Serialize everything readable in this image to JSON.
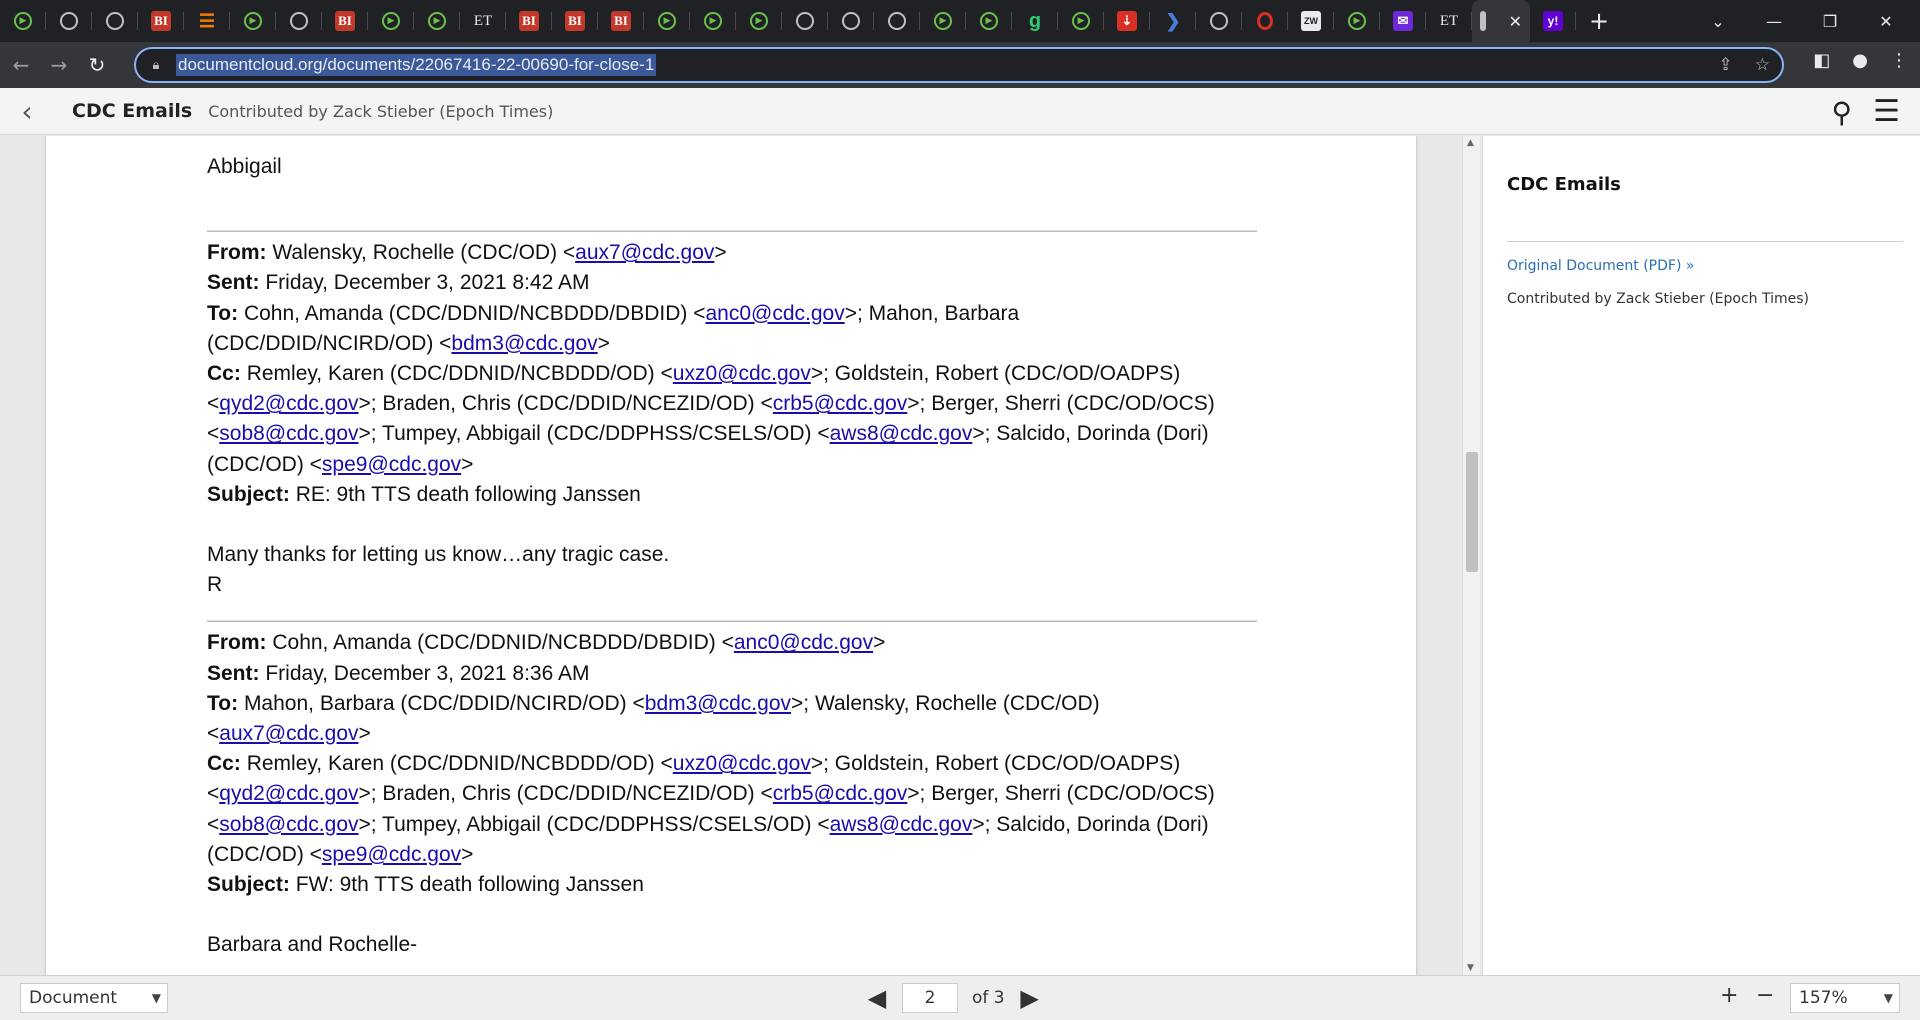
{
  "browser": {
    "tabs": [
      {
        "icon": "play-icon",
        "glyph": "▶",
        "kind": "play"
      },
      {
        "icon": "globe-icon",
        "glyph": "",
        "kind": "globe"
      },
      {
        "icon": "globe-icon",
        "glyph": "",
        "kind": "globe"
      },
      {
        "icon": "bi-icon",
        "glyph": "BI",
        "kind": "bi"
      },
      {
        "icon": "bookmark-icon",
        "glyph": "☰",
        "kind": "bookmark"
      },
      {
        "icon": "play-icon",
        "glyph": "▶",
        "kind": "play"
      },
      {
        "icon": "globe-icon",
        "glyph": "",
        "kind": "globe"
      },
      {
        "icon": "bi-icon",
        "glyph": "BI",
        "kind": "bi"
      },
      {
        "icon": "play-icon",
        "glyph": "▶",
        "kind": "play"
      },
      {
        "icon": "play-icon",
        "glyph": "▶",
        "kind": "play"
      },
      {
        "icon": "et-icon",
        "glyph": "ET",
        "kind": "et"
      },
      {
        "icon": "bi-icon",
        "glyph": "BI",
        "kind": "bi"
      },
      {
        "icon": "bi-icon",
        "glyph": "BI",
        "kind": "bi"
      },
      {
        "icon": "bi-icon",
        "glyph": "BI",
        "kind": "bi"
      },
      {
        "icon": "play-icon",
        "glyph": "▶",
        "kind": "play"
      },
      {
        "icon": "play-icon",
        "glyph": "▶",
        "kind": "play"
      },
      {
        "icon": "play-icon",
        "glyph": "▶",
        "kind": "play"
      },
      {
        "icon": "globe-icon",
        "glyph": "",
        "kind": "globe"
      },
      {
        "icon": "globe-icon",
        "glyph": "",
        "kind": "globe"
      },
      {
        "icon": "globe-icon",
        "glyph": "",
        "kind": "globe"
      },
      {
        "icon": "play-icon",
        "glyph": "▶",
        "kind": "play"
      },
      {
        "icon": "play-icon",
        "glyph": "▶",
        "kind": "play"
      },
      {
        "icon": "g-icon",
        "glyph": "g",
        "kind": "g"
      },
      {
        "icon": "play-icon",
        "glyph": "▶",
        "kind": "play"
      },
      {
        "icon": "red-app-icon",
        "glyph": "⇣",
        "kind": "red"
      },
      {
        "icon": "blue-arrow-icon",
        "glyph": "❯",
        "kind": "blue"
      },
      {
        "icon": "globe-icon",
        "glyph": "",
        "kind": "globe"
      },
      {
        "icon": "opera-icon",
        "glyph": "",
        "kind": "redo"
      },
      {
        "icon": "wp-icon",
        "glyph": "ZW",
        "kind": "wp"
      },
      {
        "icon": "play-icon",
        "glyph": "▶",
        "kind": "play"
      },
      {
        "icon": "mail-icon",
        "glyph": "✉",
        "kind": "purple"
      },
      {
        "icon": "et-icon",
        "glyph": "ET",
        "kind": "et"
      }
    ],
    "active_tab_close": "✕",
    "yahoo_tab_glyph": "y!",
    "new_tab": "+",
    "window": {
      "dropdown": "⌄",
      "minimize": "—",
      "restore": "❐",
      "close": "✕"
    },
    "nav": {
      "back": "←",
      "forward": "→",
      "reload": "↻"
    },
    "url": "documentcloud.org/documents/22067416-22-00690-for-close-1",
    "omnibox_icons": {
      "share": "⇪",
      "star": "☆"
    },
    "toolbar_icons": {
      "sidepanel": "◧",
      "profile": "●",
      "menu": "⋮"
    }
  },
  "viewer": {
    "back_glyph": "‹",
    "title": "CDC Emails",
    "contributor": "Contributed by Zack Stieber (Epoch Times)",
    "search_glyph": "⚲",
    "menu_glyph": "☰"
  },
  "document": {
    "signature": "Abbigail",
    "email1": {
      "from_label": "From:",
      "from": "Walensky, Rochelle (CDC/OD) <",
      "from_email": "aux7@cdc.gov",
      "from_end": ">",
      "sent_label": "Sent:",
      "sent": "Friday, December 3, 2021 8:42 AM",
      "to_label": "To:",
      "to_line1_a": "Cohn, Amanda (CDC/DDNID/NCBDDD/DBDID) <",
      "to_line1_email": "anc0@cdc.gov",
      "to_line1_b": ">; Mahon, Barbara",
      "to_line2_a": "(CDC/DDID/NCIRD/OD) <",
      "to_line2_email": "bdm3@cdc.gov",
      "to_line2_b": ">",
      "cc_label": "Cc:",
      "cc_line1_a": "Remley, Karen (CDC/DDNID/NCBDDD/OD) <",
      "cc_line1_email": "uxz0@cdc.gov",
      "cc_line1_b": ">; Goldstein, Robert (CDC/OD/OADPS)",
      "cc_line2_a": "<",
      "cc_line2_email1": "qyd2@cdc.gov",
      "cc_line2_b": ">; Braden, Chris (CDC/DDID/NCEZID/OD) <",
      "cc_line2_email2": "crb5@cdc.gov",
      "cc_line2_c": ">; Berger, Sherri (CDC/OD/OCS)",
      "cc_line3_a": "<",
      "cc_line3_email1": "sob8@cdc.gov",
      "cc_line3_b": ">; Tumpey, Abbigail (CDC/DDPHSS/CSELS/OD) <",
      "cc_line3_email2": "aws8@cdc.gov",
      "cc_line3_c": ">; Salcido, Dorinda (Dori)",
      "cc_line4_a": "(CDC/OD) <",
      "cc_line4_email": "spe9@cdc.gov",
      "cc_line4_b": ">",
      "subject_label": "Subject:",
      "subject": "RE: 9th TTS death following Janssen",
      "body1": "Many thanks for letting us know…any tragic case.",
      "body2": "R"
    },
    "email2": {
      "from_label": "From:",
      "from": "Cohn, Amanda (CDC/DDNID/NCBDDD/DBDID) <",
      "from_email": "anc0@cdc.gov",
      "from_end": ">",
      "sent_label": "Sent:",
      "sent": "Friday, December 3, 2021 8:36 AM",
      "to_label": "To:",
      "to_line1_a": "Mahon, Barbara (CDC/DDID/NCIRD/OD) <",
      "to_line1_email": "bdm3@cdc.gov",
      "to_line1_b": ">; Walensky, Rochelle (CDC/OD)",
      "to_line2_a": "<",
      "to_line2_email": "aux7@cdc.gov",
      "to_line2_b": ">",
      "cc_label": "Cc:",
      "cc_line1_a": "Remley, Karen (CDC/DDNID/NCBDDD/OD) <",
      "cc_line1_email": "uxz0@cdc.gov",
      "cc_line1_b": ">; Goldstein, Robert (CDC/OD/OADPS)",
      "cc_line2_a": "<",
      "cc_line2_email1": "qyd2@cdc.gov",
      "cc_line2_b": ">; Braden, Chris (CDC/DDID/NCEZID/OD) <",
      "cc_line2_email2": "crb5@cdc.gov",
      "cc_line2_c": ">; Berger, Sherri (CDC/OD/OCS)",
      "cc_line3_a": "<",
      "cc_line3_email1": "sob8@cdc.gov",
      "cc_line3_b": ">; Tumpey, Abbigail (CDC/DDPHSS/CSELS/OD) <",
      "cc_line3_email2": "aws8@cdc.gov",
      "cc_line3_c": ">; Salcido, Dorinda (Dori)",
      "cc_line4_a": "(CDC/OD) <",
      "cc_line4_email": "spe9@cdc.gov",
      "cc_line4_b": ">",
      "subject_label": "Subject:",
      "subject": "FW: 9th TTS death following Janssen",
      "body1": "Barbara and Rochelle-"
    },
    "scroll_up": "▲",
    "scroll_down": "▼"
  },
  "sidebar": {
    "title": "CDC Emails",
    "original_link": "Original Document (PDF) »",
    "contributor": "Contributed by Zack Stieber (Epoch Times)"
  },
  "footer": {
    "mode": "Document",
    "caret": "▼",
    "prev": "◀",
    "page": "2",
    "of_total": "of 3",
    "next": "▶",
    "zoom_in": "+",
    "zoom_out": "−",
    "zoom": "157%"
  }
}
